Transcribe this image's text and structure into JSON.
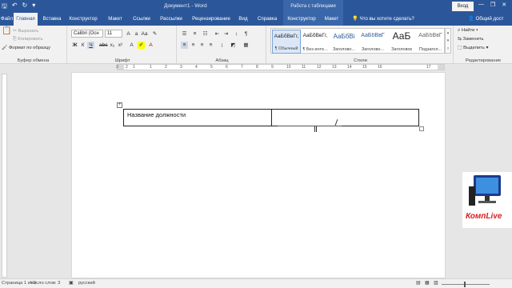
{
  "title_bar": {
    "document_title": "Документ1 - Word",
    "context_title": "Работа с таблицами",
    "login": "Вход",
    "minimize": "—",
    "restore": "❐",
    "close": "✕"
  },
  "tabs": {
    "file": "Файл",
    "items": [
      "Главная",
      "Вставка",
      "Конструктор",
      "Макет",
      "Ссылки",
      "Рассылки",
      "Рецензирование",
      "Вид",
      "Справка",
      "Конструктор",
      "Макет"
    ],
    "active_index": 0,
    "tell_me": "Что вы хотите сделать?",
    "share": "Общий дост"
  },
  "clipboard": {
    "cut": "Вырезать",
    "copy": "Копировать",
    "format_painter": "Формат по образцу",
    "label": "Буфер обмена"
  },
  "font": {
    "name": "Calibri (Осн",
    "size": "11",
    "label": "Шрифт"
  },
  "paragraph": {
    "label": "Абзац"
  },
  "styles": {
    "label": "Стили",
    "items": [
      {
        "sample": "АаБбВвГг,",
        "name": "¶ Обычный"
      },
      {
        "sample": "АаБбВвГг,",
        "name": "¶ Без инте..."
      },
      {
        "sample": "АаБбВі",
        "name": "Заголово..."
      },
      {
        "sample": "АаБбВвГ",
        "name": "Заголово..."
      },
      {
        "sample": "АаБ",
        "name": "Заголовок"
      },
      {
        "sample": "АаБбВвГ",
        "name": "Подзагол..."
      }
    ]
  },
  "editing": {
    "find": "Найти",
    "replace": "Заменить",
    "select": "Выделить",
    "label": "Редактирование"
  },
  "ruler": {
    "numbers": [
      "3",
      "2",
      "1",
      "1",
      "2",
      "3",
      "4",
      "5",
      "6",
      "7",
      "8",
      "9",
      "10",
      "11",
      "12",
      "13",
      "14",
      "15",
      "16",
      "17"
    ]
  },
  "document": {
    "table": {
      "cell1": "Название должности",
      "cell2": ""
    }
  },
  "status": {
    "page": "Страница 1 из 1",
    "words": "Число слов: 3",
    "language": "русский"
  },
  "logo": {
    "text": "КомпLive"
  },
  "colors": {
    "accent": "#2b579a",
    "logo_red": "#d81e1e"
  }
}
